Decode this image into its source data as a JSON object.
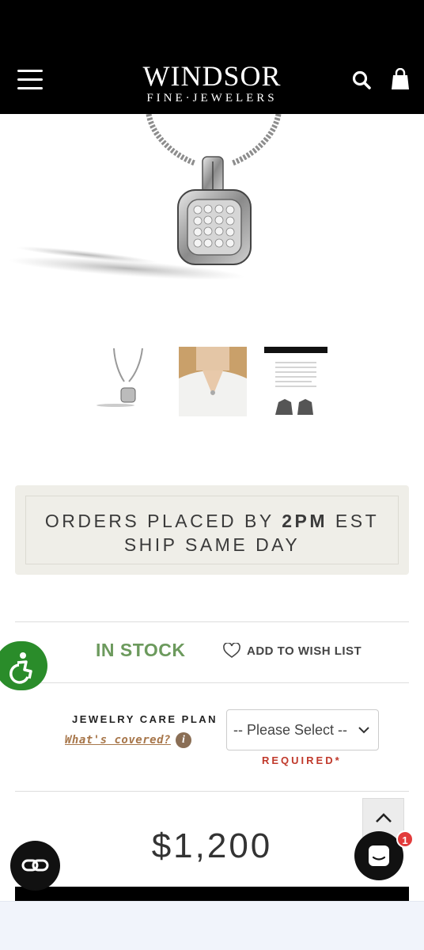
{
  "header": {
    "logo_main": "WINDSOR",
    "logo_sub": "FINE·JEWELERS"
  },
  "shipping": {
    "line1_pre": "ORDERS PLACED BY ",
    "line1_bold": "2PM",
    "line1_post": " EST",
    "line2": "SHIP SAME DAY"
  },
  "stock": {
    "status": "IN STOCK",
    "wishlist_label": "ADD TO WISH LIST"
  },
  "care_plan": {
    "label": "JEWELRY CARE PLAN",
    "link": "What's covered?",
    "info_glyph": "i",
    "select_value": "-- Please Select --",
    "required": "REQUIRED*"
  },
  "price": "$1,200",
  "chat": {
    "badge_count": "1"
  },
  "colors": {
    "in_stock": "#6c9a5d",
    "required": "#c0392b",
    "accessibility": "#2a8c2a",
    "link": "#a7764a",
    "shipping_bg": "#efeee8"
  }
}
